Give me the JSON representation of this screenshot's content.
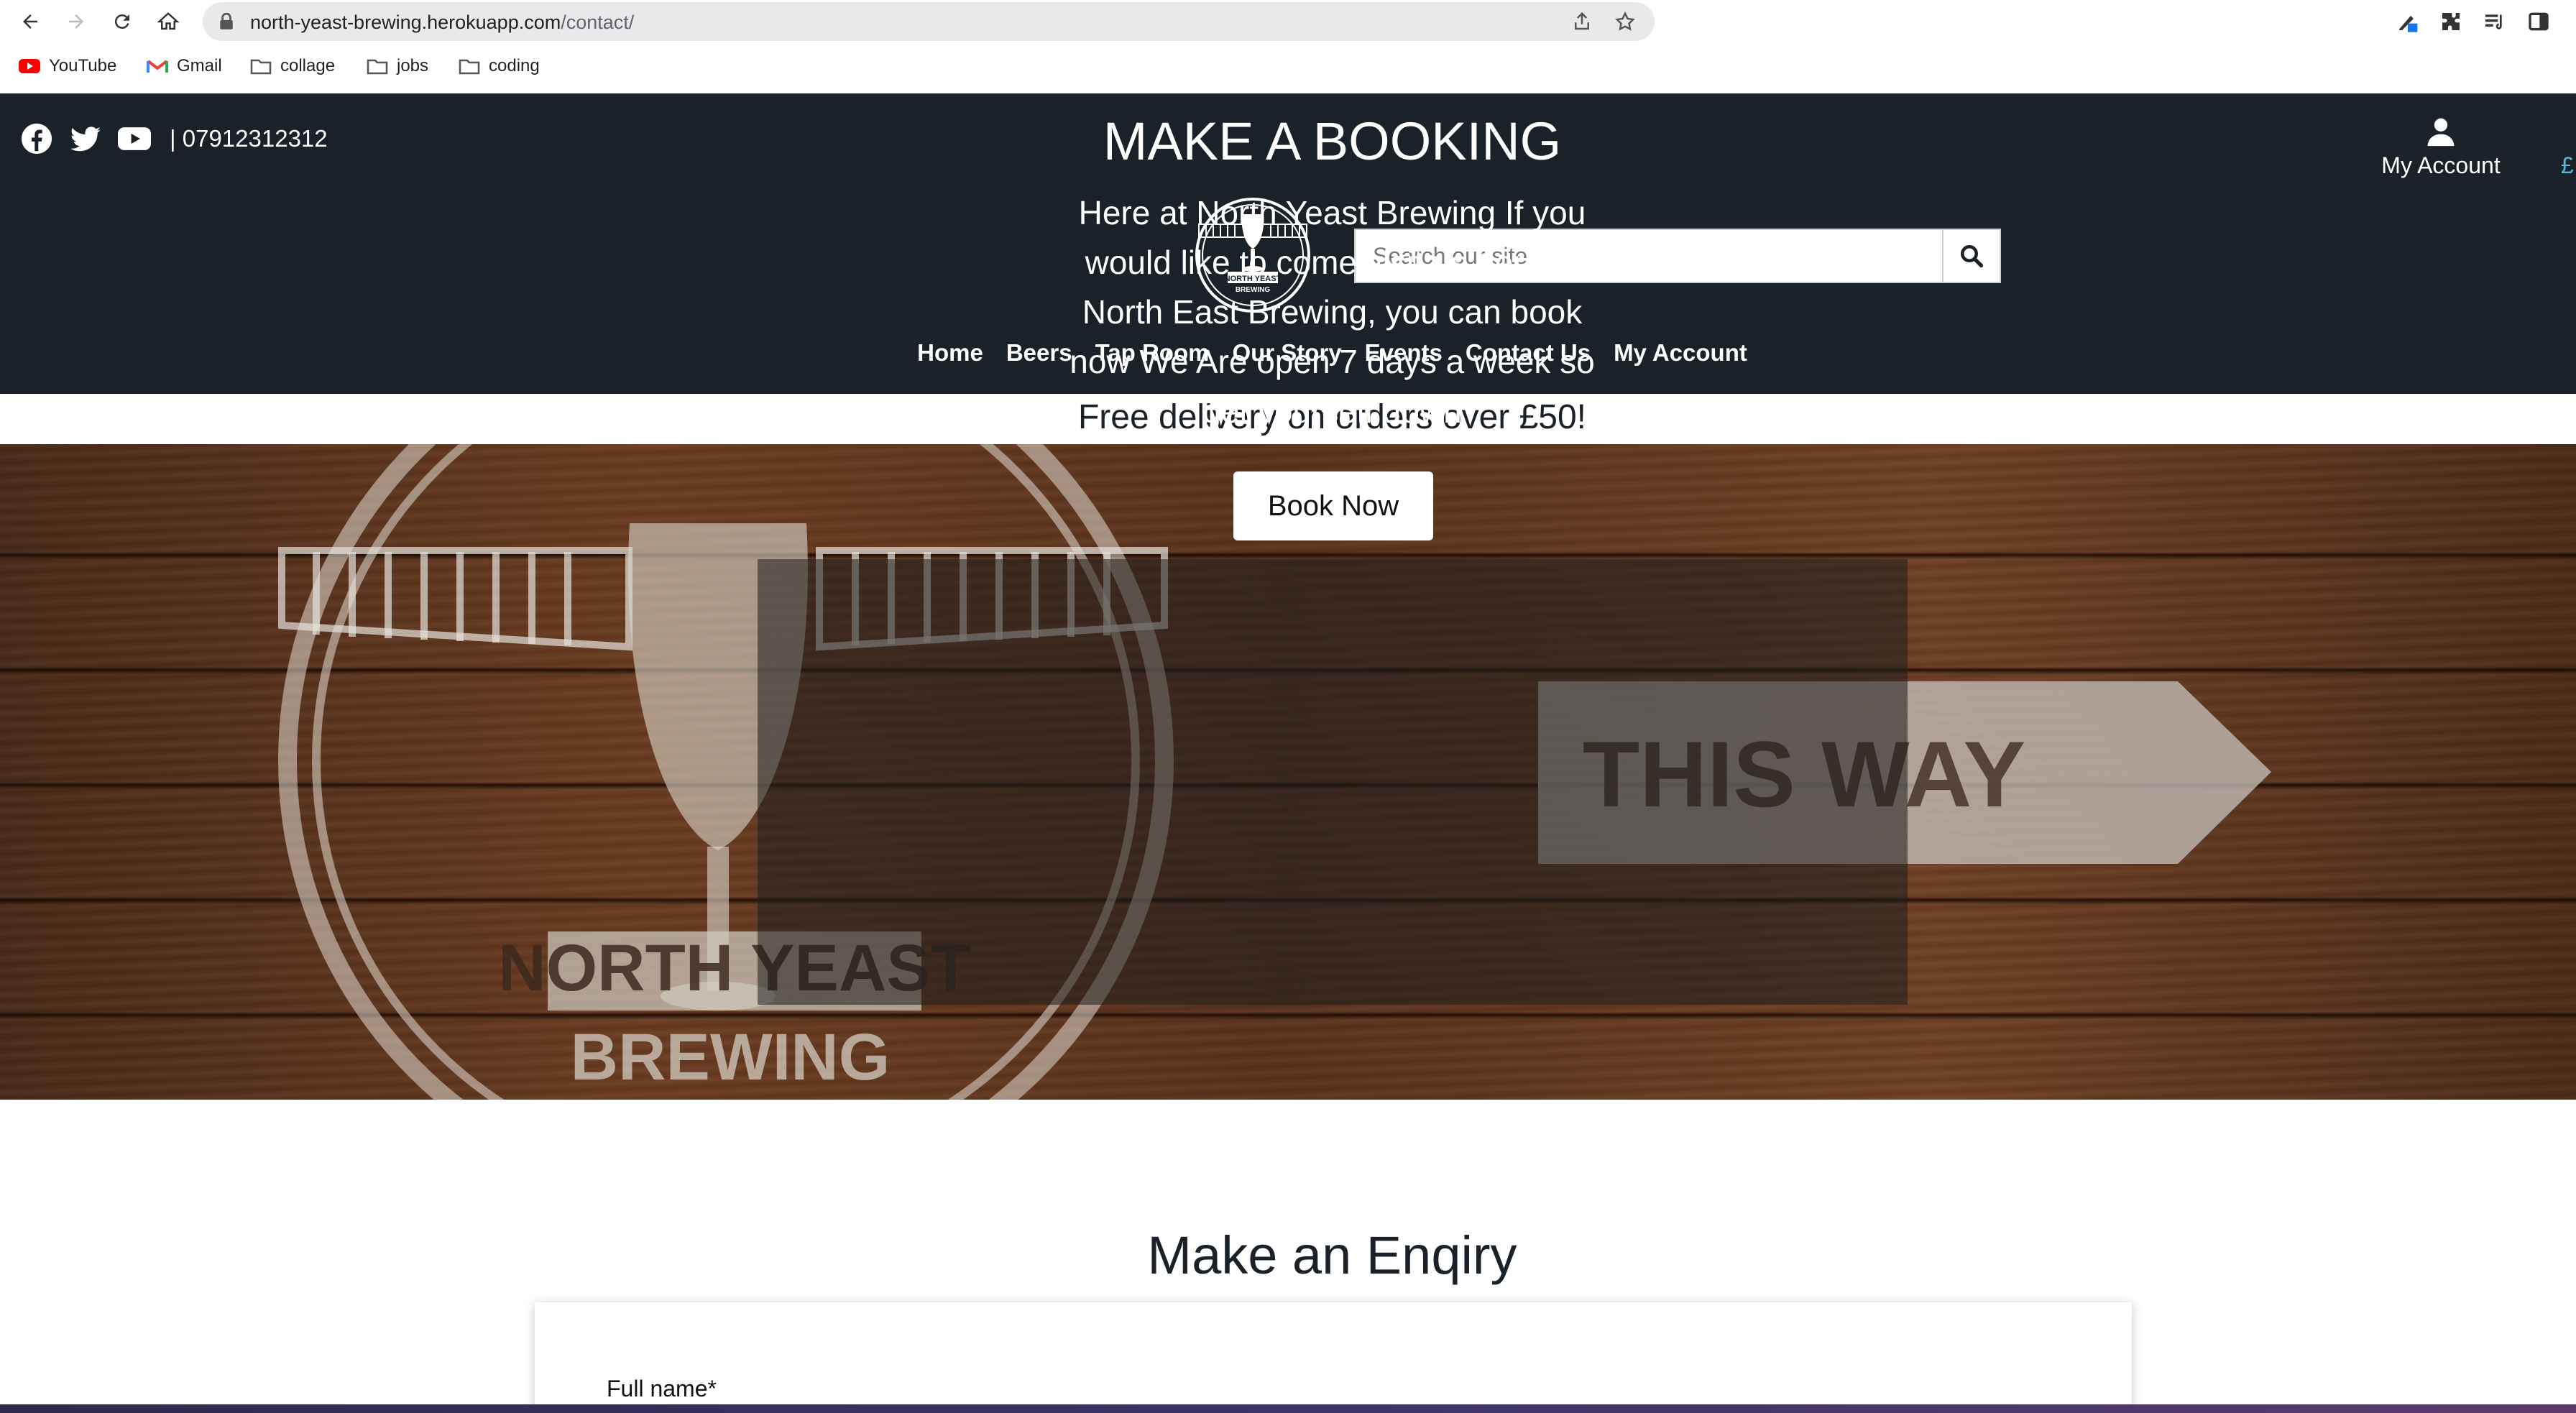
{
  "browser": {
    "url_domain": "north-yeast-brewing.herokuapp.com",
    "url_path": "/contact/",
    "bookmarks": [
      {
        "label": "YouTube",
        "icon": "youtube-icon"
      },
      {
        "label": "Gmail",
        "icon": "gmail-icon"
      },
      {
        "label": "collage",
        "icon": "folder-icon"
      },
      {
        "label": "jobs",
        "icon": "folder-icon"
      },
      {
        "label": "coding",
        "icon": "folder-icon"
      }
    ]
  },
  "header": {
    "phone": "| 07912312312",
    "account_label": "My Account",
    "cart_peek": "£",
    "logo_text": [
      "NORTH YEAST",
      "BREWING"
    ],
    "search_placeholder": "Search our site",
    "nav": [
      "Home",
      "Beers",
      "Tap Room",
      "Our Story",
      "Events",
      "Contact Us",
      "My Account"
    ],
    "colors": {
      "background": "#1b2129",
      "accent": "#5bb8d8"
    }
  },
  "promo": "Free delivery on orders over £50!",
  "hero": {
    "title": "MAKE A BOOKING",
    "text": "Here at North Yeast Brewing If you would like to come visit us here at North East Brewing, you can book now We Are open 7 days a week so get yourself down",
    "button": "Book Now",
    "background_text": [
      "NORTH YEAST",
      "BREWING",
      "THIS WAY"
    ]
  },
  "enquiry": {
    "title": "Make an Enqiry",
    "full_name_label": "Full name*"
  }
}
